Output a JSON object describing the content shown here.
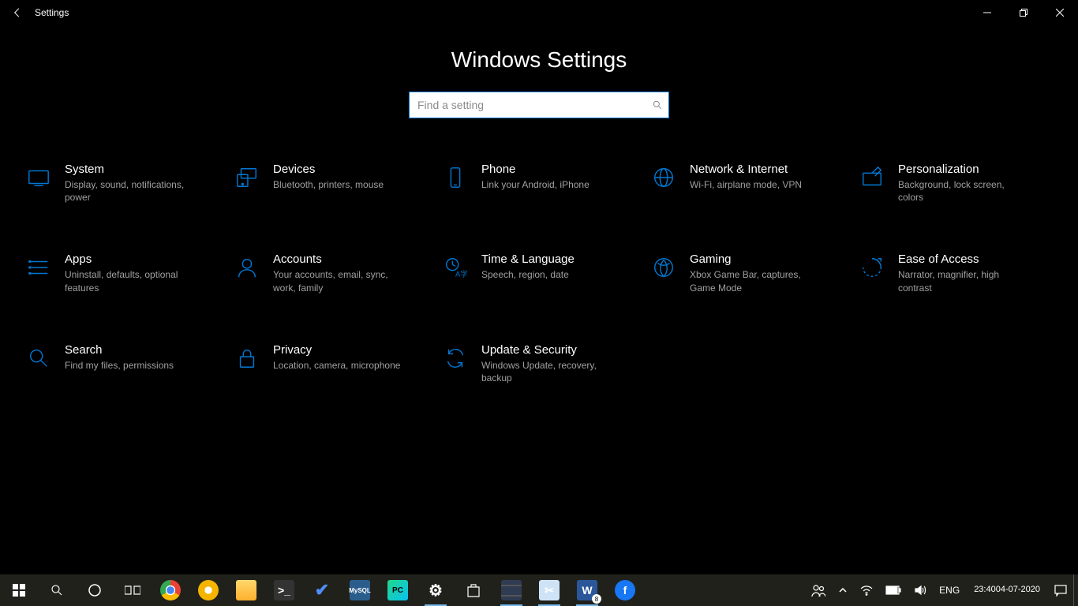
{
  "titlebar": {
    "app_title": "Settings"
  },
  "page": {
    "heading": "Windows Settings"
  },
  "search": {
    "placeholder": "Find a setting"
  },
  "categories": [
    {
      "key": "system",
      "title": "System",
      "desc": "Display, sound, notifications, power"
    },
    {
      "key": "devices",
      "title": "Devices",
      "desc": "Bluetooth, printers, mouse"
    },
    {
      "key": "phone",
      "title": "Phone",
      "desc": "Link your Android, iPhone"
    },
    {
      "key": "network",
      "title": "Network & Internet",
      "desc": "Wi-Fi, airplane mode, VPN"
    },
    {
      "key": "personalization",
      "title": "Personalization",
      "desc": "Background, lock screen, colors"
    },
    {
      "key": "apps",
      "title": "Apps",
      "desc": "Uninstall, defaults, optional features"
    },
    {
      "key": "accounts",
      "title": "Accounts",
      "desc": "Your accounts, email, sync, work, family"
    },
    {
      "key": "time-language",
      "title": "Time & Language",
      "desc": "Speech, region, date"
    },
    {
      "key": "gaming",
      "title": "Gaming",
      "desc": "Xbox Game Bar, captures, Game Mode"
    },
    {
      "key": "ease-of-access",
      "title": "Ease of Access",
      "desc": "Narrator, magnifier, high contrast"
    },
    {
      "key": "search",
      "title": "Search",
      "desc": "Find my files, permissions"
    },
    {
      "key": "privacy",
      "title": "Privacy",
      "desc": "Location, camera, microphone"
    },
    {
      "key": "update-security",
      "title": "Update & Security",
      "desc": "Windows Update, recovery, backup"
    }
  ],
  "taskbar": {
    "tray": {
      "language": "ENG",
      "time": "23:40",
      "date": "04-07-2020",
      "word_badge": "8"
    }
  }
}
